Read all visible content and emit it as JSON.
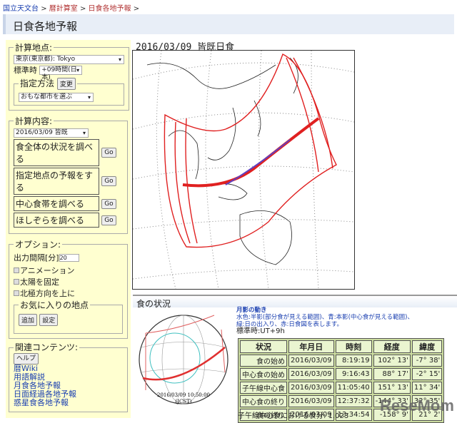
{
  "breadcrumb": [
    {
      "label": "国立天文台"
    },
    {
      "label": "暦計算室"
    },
    {
      "label": "日食各地予報"
    }
  ],
  "breadcrumb_sep": ">",
  "page_title": "日食各地予報",
  "location": {
    "legend": "計算地点:",
    "city": "東京(東京都): Tokyo",
    "tz_label": "標準時",
    "tz": "+09時間(日本)",
    "method_legend": "指定方法",
    "change": "変更",
    "method": "おもな都市を選ぶ"
  },
  "calc": {
    "legend": "計算内容:",
    "eclipse": "2016/03/09 皆既",
    "items": [
      {
        "label": "食全体の状況を調べる"
      },
      {
        "label": "指定地点の予報をする"
      },
      {
        "label": "中心食帯を調べる"
      },
      {
        "label": "ほしぞらを調べる"
      }
    ],
    "go": "Go"
  },
  "options": {
    "legend": "オプション:",
    "interval_label": "出力間隔[分]",
    "interval": "20",
    "checks": [
      {
        "label": "アニメーション"
      },
      {
        "label": "太陽を固定"
      },
      {
        "label": "北極方向を上に"
      }
    ],
    "fav_legend": "お気に入りの地点",
    "add": "追加",
    "settings": "設定"
  },
  "related": {
    "legend": "関連コンテンツ:",
    "help": "ヘルプ",
    "links": [
      {
        "label": "暦Wiki"
      },
      {
        "label": "用語解説"
      },
      {
        "label": "月食各地予報"
      },
      {
        "label": "日面経過各地予報"
      },
      {
        "label": "惑星食各地予報"
      }
    ]
  },
  "map_title": "2016/03/09 皆既日食",
  "status": {
    "title": "食の状況",
    "globe_time": "2016/03/09 10:50:00",
    "globe_tz": "(JCST)",
    "shadow_title": "月影の動き",
    "desc1": "水色:半影(部分食が見える範囲)、青:本影(中心食が見える範囲)、",
    "desc2": "緑:日の出入り、赤:日食図を表します。",
    "std_time": "標準時:UT+9h",
    "headers": [
      "状況",
      "年月日",
      "時刻",
      "経度",
      "緯度"
    ],
    "rows": [
      [
        "食の始め",
        "2016/03/09",
        "8:19:19",
        "102° 13'",
        "-7° 38'"
      ],
      [
        "中心食の始め",
        "2016/03/09",
        "9:16:43",
        "88° 17'",
        "-2° 15'"
      ],
      [
        "子午線中心食",
        "2016/03/09",
        "11:05:40",
        "151° 13'",
        "11° 34'"
      ],
      [
        "中心食の終り",
        "2016/03/09",
        "12:37:32",
        "-144° 33'",
        "32° 35'"
      ],
      [
        "食の終り",
        "2016/03/09",
        "13:34:54",
        "-158° 9'",
        "21° 2'"
      ]
    ],
    "magnitude": "子午線中心食における食分: 1.023"
  },
  "watermark": "ReseMom"
}
